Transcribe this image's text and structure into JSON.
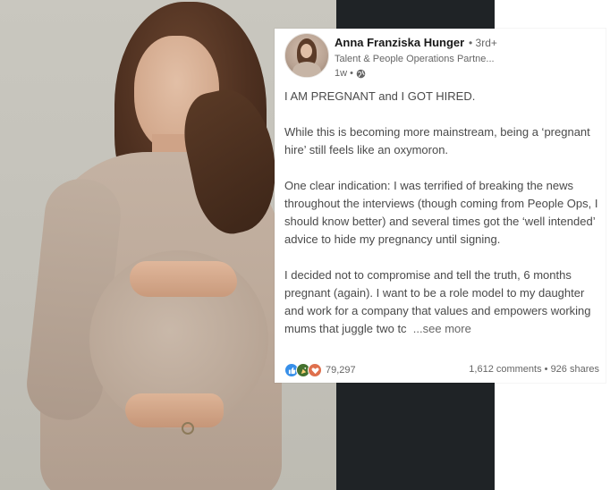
{
  "post": {
    "author": {
      "name": "Anna Franziska Hunger",
      "degree": "• 3rd+",
      "headline": "Talent & People Operations Partne...",
      "time": "1w •",
      "visibility_icon": "globe-icon"
    },
    "body": {
      "p1": "I AM PREGNANT and I GOT HIRED.",
      "p2": "While this is becoming more mainstream, being a ‘pregnant hire’ still feels like an oxymoron.",
      "p3": "One clear indication: I was terrified of breaking the news throughout the interviews (though coming from People Ops, I should know better) and several times got the  ‘well intended’ advice to hide my pregnancy until signing.",
      "p4": "I decided not to compromise and tell the truth, 6 months pregnant (again). I want to be a role model to my daughter and work for a company that values and empowers working mums that juggle two tc",
      "see_more": "...see more"
    },
    "social": {
      "reaction_icons": [
        "like-icon",
        "celebrate-icon",
        "love-icon"
      ],
      "reactions_count": "79,297",
      "comments_shares": "1,612 comments • 926 shares"
    }
  },
  "colors": {
    "dark_panel": "#1f2326",
    "like": "#378fe9",
    "celebrate": "#44712e",
    "love": "#df704d"
  }
}
